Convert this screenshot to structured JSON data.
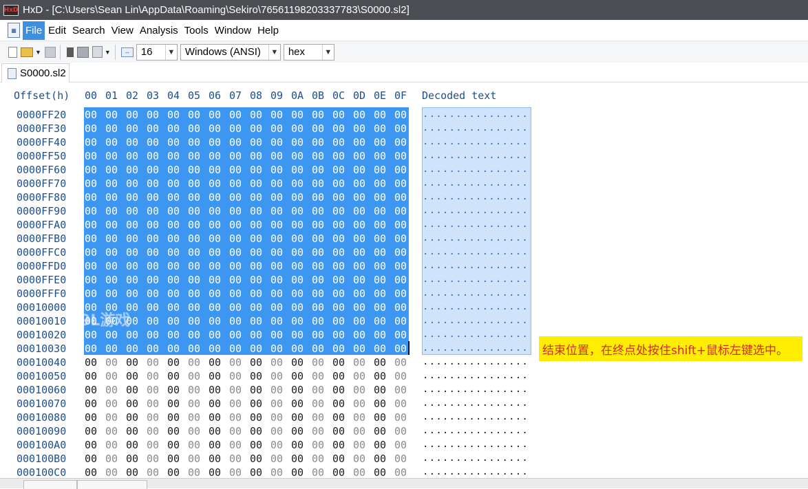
{
  "window": {
    "title": "HxD - [C:\\Users\\Sean Lin\\AppData\\Roaming\\Sekiro\\76561198203337783\\S0000.sl2]",
    "app_icon_text": "HxD"
  },
  "menu": {
    "items": [
      "File",
      "Edit",
      "Search",
      "View",
      "Analysis",
      "Tools",
      "Window",
      "Help"
    ],
    "active": "File"
  },
  "toolbar": {
    "bytes_per_row": "16",
    "charset": "Windows (ANSI)",
    "offset_base": "hex"
  },
  "tabs": [
    {
      "label": "S0000.sl2",
      "active": true
    }
  ],
  "hex_view": {
    "offset_header": "Offset(h)",
    "column_headers": [
      "00",
      "01",
      "02",
      "03",
      "04",
      "05",
      "06",
      "07",
      "08",
      "09",
      "0A",
      "0B",
      "0C",
      "0D",
      "0E",
      "0F"
    ],
    "decoded_header": "Decoded text",
    "rows": [
      {
        "offset": "0000FF20",
        "selected": true
      },
      {
        "offset": "0000FF30",
        "selected": true
      },
      {
        "offset": "0000FF40",
        "selected": true
      },
      {
        "offset": "0000FF50",
        "selected": true
      },
      {
        "offset": "0000FF60",
        "selected": true
      },
      {
        "offset": "0000FF70",
        "selected": true
      },
      {
        "offset": "0000FF80",
        "selected": true
      },
      {
        "offset": "0000FF90",
        "selected": true
      },
      {
        "offset": "0000FFA0",
        "selected": true
      },
      {
        "offset": "0000FFB0",
        "selected": true
      },
      {
        "offset": "0000FFC0",
        "selected": true
      },
      {
        "offset": "0000FFD0",
        "selected": true
      },
      {
        "offset": "0000FFE0",
        "selected": true
      },
      {
        "offset": "0000FFF0",
        "selected": true
      },
      {
        "offset": "00010000",
        "selected": true
      },
      {
        "offset": "00010010",
        "selected": true
      },
      {
        "offset": "00010020",
        "selected": true
      },
      {
        "offset": "00010030",
        "selected": true
      },
      {
        "offset": "00010040",
        "selected": false
      },
      {
        "offset": "00010050",
        "selected": false
      },
      {
        "offset": "00010060",
        "selected": false
      },
      {
        "offset": "00010070",
        "selected": false
      },
      {
        "offset": "00010080",
        "selected": false
      },
      {
        "offset": "00010090",
        "selected": false
      },
      {
        "offset": "000100A0",
        "selected": false
      },
      {
        "offset": "000100B0",
        "selected": false
      },
      {
        "offset": "000100C0",
        "selected": false
      }
    ],
    "byte_value": "00",
    "decoded_row": "................"
  },
  "annotation": {
    "text": "结束位置，在终点处按住shift+鼠标左键选中。"
  },
  "watermark": {
    "text": "9L游戏"
  },
  "colors": {
    "titlebar": "#4b4d52",
    "selection": "#3d96f0",
    "selection_text_pane": "#cfe4fb",
    "offset_text": "#1d4f8e",
    "callout_bg": "#ffee00",
    "callout_text": "#d22b2b"
  },
  "icons": [
    "app-icon",
    "document-icon",
    "new-file-icon",
    "open-file-icon",
    "save-icon",
    "bytes-per-row-icon"
  ]
}
